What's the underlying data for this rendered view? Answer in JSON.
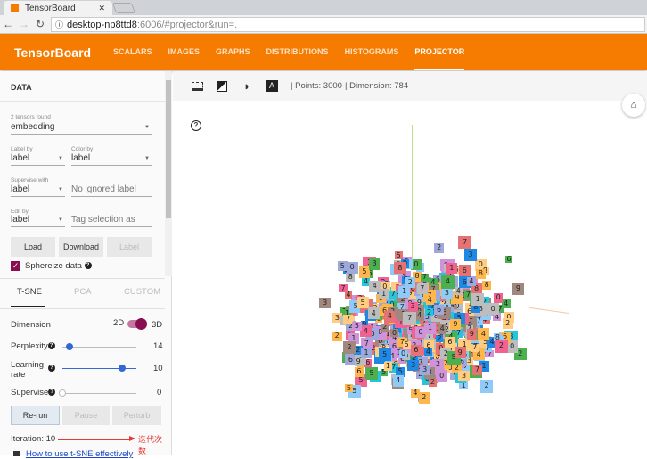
{
  "browser": {
    "tab_title": "TensorBoard",
    "url_host": "desktop-np8ttd8",
    "url_rest": ":6006/#projector&run=."
  },
  "header": {
    "brand": "TensorBoard",
    "nav": [
      "SCALARS",
      "IMAGES",
      "GRAPHS",
      "DISTRIBUTIONS",
      "HISTOGRAMS",
      "PROJECTOR"
    ],
    "active": "PROJECTOR",
    "color": "#f57c00"
  },
  "data_panel": {
    "title": "DATA",
    "tensors_label": "2 tensors found",
    "tensor": "embedding",
    "label_by_label": "Label by",
    "label_by": "label",
    "color_by_label": "Color by",
    "color_by": "label",
    "supervise_label": "Supervise with",
    "supervise": "label",
    "ignored_placeholder": "No ignored label",
    "edit_label": "Edit by",
    "edit_by": "label",
    "tag_placeholder": "Tag selection as",
    "load": "Load",
    "download": "Download",
    "label_btn": "Label",
    "sphereize": "Sphereize data",
    "sphereize_checked": true
  },
  "tsne": {
    "tabs": [
      "T-SNE",
      "PCA",
      "CUSTOM"
    ],
    "active_tab": "T-SNE",
    "dimension_label": "Dimension",
    "dim_2d": "2D",
    "dim_3d": "3D",
    "dimension": "3D",
    "perplexity_label": "Perplexity",
    "perplexity": "14",
    "learning_label": "Learning",
    "learning_label2": "rate",
    "learning_rate": "10",
    "supervise_label": "Supervise",
    "supervise": "0",
    "rerun": "Re-run",
    "pause": "Pause",
    "perturb": "Perturb",
    "iteration": "Iteration: 10",
    "annotation": "迭代次数",
    "help_link": "How to use t-SNE effectively"
  },
  "toolbar": {
    "points": "| Points: 3000",
    "dimension": "| Dimension: 784",
    "icons": [
      "selection-icon",
      "night-mode-icon",
      "moon-icon",
      "label-icon"
    ]
  },
  "scatter": {
    "colors": [
      "#e57373",
      "#4caf50",
      "#f06292",
      "#26c6da",
      "#ffb74d",
      "#9fa8da",
      "#bdbdbd",
      "#ce93d8",
      "#90caf9",
      "#a1887f",
      "#1e88e5",
      "#ffcc80"
    ]
  }
}
